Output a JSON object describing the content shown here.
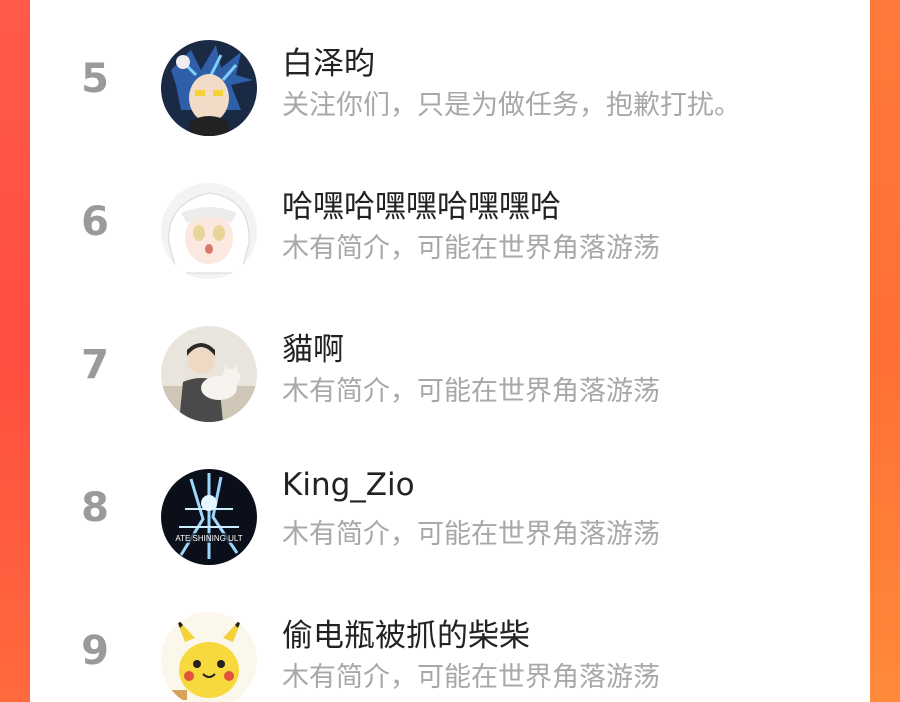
{
  "colors": {
    "background_left": "#ff4d3f",
    "background_right": "#ff7a3a",
    "panel": "#ffffff",
    "rank_text": "#9a9a9a",
    "name_text": "#222222",
    "bio_text": "#a8a8a8"
  },
  "ranking": {
    "items": [
      {
        "rank": "5",
        "name": "白泽昀",
        "bio": "关注你们，只是为做任务，抱歉打扰。",
        "avatar": "anime-boy-blue-hair-avatar"
      },
      {
        "rank": "6",
        "name": "哈嘿哈嘿嘿哈嘿嘿哈",
        "bio": "木有简介，可能在世界角落游荡",
        "avatar": "anime-girl-white-hair-avatar"
      },
      {
        "rank": "7",
        "name": "貓啊",
        "bio": "木有简介，可能在世界角落游荡",
        "avatar": "person-with-cat-avatar"
      },
      {
        "rank": "8",
        "name": "King_Zio",
        "bio": "木有简介，可能在世界角落游荡",
        "avatar": "ultraman-shining-avatar"
      },
      {
        "rank": "9",
        "name": "偷电瓶被抓的柴柴",
        "bio": "木有简介，可能在世界角落游荡",
        "avatar": "pikachu-avatar"
      }
    ]
  }
}
